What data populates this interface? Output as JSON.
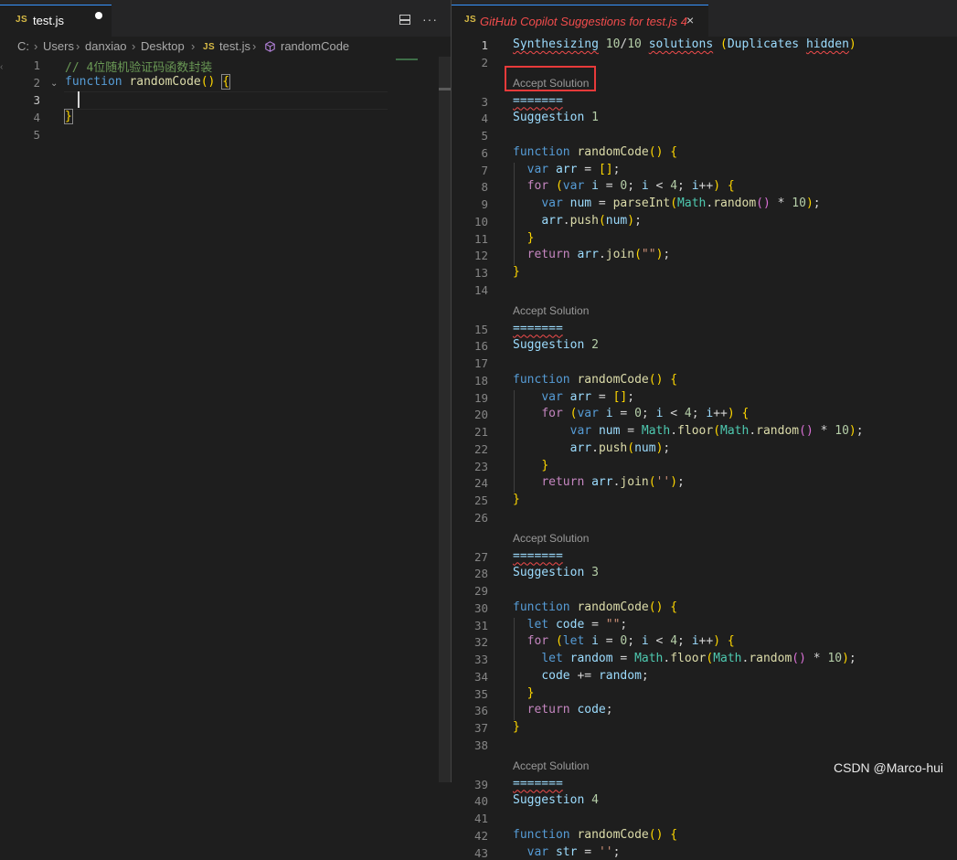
{
  "left_editor": {
    "tab": {
      "badge": "JS",
      "title": "test.js",
      "dirty": true
    },
    "breadcrumb": [
      "C:",
      "Users",
      "danxiao",
      "Desktop",
      "test.js",
      "randomCode"
    ],
    "breadcrumb_badge": "JS",
    "actions": {
      "split": "split-editor",
      "more": "···"
    },
    "line_numbers": [
      "1",
      "2",
      "3",
      "4",
      "5"
    ],
    "lines": [
      {
        "comment": "// 4位随机验证码函数封装"
      },
      {
        "kw": "function",
        "name": "randomCode",
        "parens": "()",
        "brace": "{"
      },
      {
        "text": ""
      },
      {
        "brace": "}"
      },
      {
        "text": ""
      }
    ],
    "active_line": "3"
  },
  "right_editor": {
    "tab": {
      "badge": "JS",
      "title": "GitHub Copilot Suggestions for test.js",
      "count": "4",
      "close": "×"
    },
    "header": "Synthesizing 10/10 solutions (Duplicates hidden)",
    "accept_label": "Accept Solution",
    "separator": "=======",
    "suggestions": [
      {
        "title": "Suggestion 1",
        "lines": [
          "function randomCode() {",
          "  var arr = [];",
          "  for (var i = 0; i < 4; i++) {",
          "    var num = parseInt(Math.random() * 10);",
          "    arr.push(num);",
          "  }",
          "  return arr.join(\"\");"
        ]
      },
      {
        "title": "Suggestion 2",
        "lines": [
          "function randomCode() {",
          "    var arr = [];",
          "    for (var i = 0; i < 4; i++) {",
          "        var num = Math.floor(Math.random() * 10);",
          "        arr.push(num);",
          "    }",
          "    return arr.join('');"
        ]
      },
      {
        "title": "Suggestion 3",
        "lines": [
          "function randomCode() {",
          "  let code = \"\";",
          "  for (let i = 0; i < 4; i++) {",
          "    let random = Math.floor(Math.random() * 10);",
          "    code += random;",
          "  }",
          "  return code;"
        ]
      },
      {
        "title": "Suggestion 4",
        "lines": [
          "function randomCode() {",
          "  var str = '';"
        ]
      }
    ],
    "line_numbers": [
      "1",
      "2",
      "3",
      "4",
      "5",
      "6",
      "7",
      "8",
      "9",
      "10",
      "11",
      "12",
      "13",
      "14",
      "15",
      "16",
      "17",
      "18",
      "19",
      "20",
      "21",
      "22",
      "23",
      "24",
      "25",
      "26",
      "27",
      "28",
      "29",
      "30",
      "31",
      "32",
      "33",
      "34",
      "35",
      "36",
      "37",
      "38",
      "39",
      "40"
    ]
  },
  "watermark": "CSDN @Marco-hui"
}
